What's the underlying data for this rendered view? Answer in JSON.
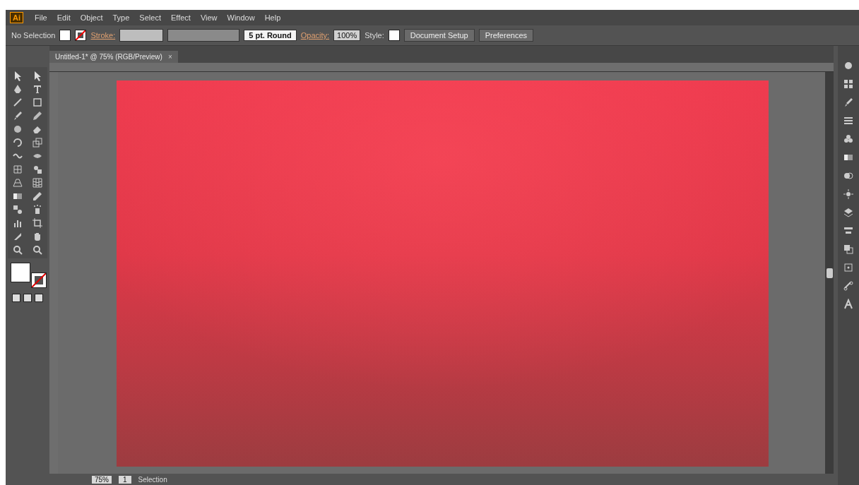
{
  "app": {
    "logo": "Ai"
  },
  "menu": [
    {
      "label": "File"
    },
    {
      "label": "Edit"
    },
    {
      "label": "Object"
    },
    {
      "label": "Type"
    },
    {
      "label": "Select"
    },
    {
      "label": "Effect"
    },
    {
      "label": "View"
    },
    {
      "label": "Window"
    },
    {
      "label": "Help"
    }
  ],
  "control_bar": {
    "selection": "No Selection",
    "stroke_label": "Stroke:",
    "brush": "5 pt. Round",
    "opacity_label": "Opacity:",
    "opacity": "100%",
    "style_label": "Style:",
    "buttons": [
      "Document Setup",
      "Preferences"
    ]
  },
  "document_tab": {
    "title": "Untitled-1* @ 75% (RGB/Preview)",
    "close": "×"
  },
  "status_bar": {
    "zoom": "75%",
    "page": "1",
    "tool": "Selection"
  }
}
